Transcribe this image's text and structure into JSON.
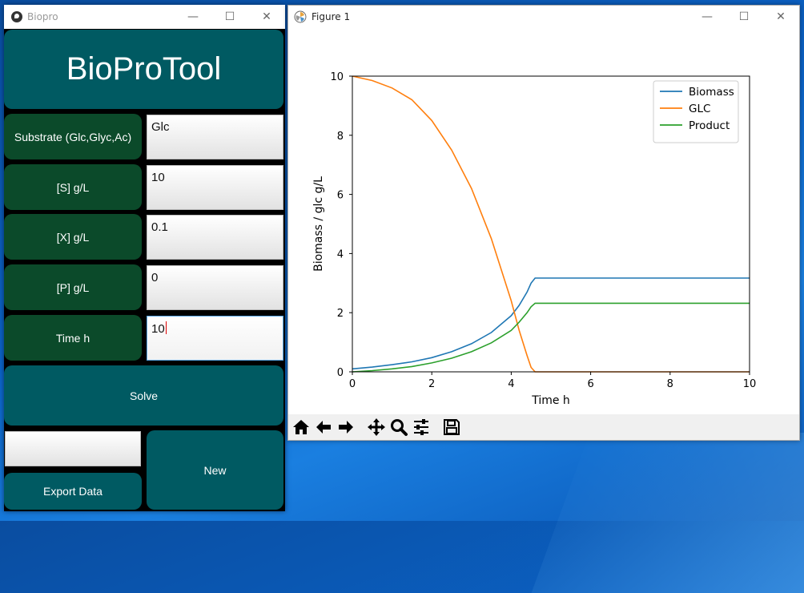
{
  "biopro": {
    "window_title": "Biopro",
    "heading": "BioProTool",
    "rows": [
      {
        "label": "Substrate (Glc,Glyc,Ac)",
        "value": "Glc"
      },
      {
        "label": "[S] g/L",
        "value": "10"
      },
      {
        "label": "[X] g/L",
        "value": "0.1"
      },
      {
        "label": "[P] g/L",
        "value": "0"
      },
      {
        "label": "Time h",
        "value": "10"
      }
    ],
    "solve_label": "Solve",
    "export_field_value": "",
    "export_label": "Export Data",
    "new_label": "New"
  },
  "figure": {
    "window_title": "Figure 1",
    "toolbar_icons": [
      "home-icon",
      "back-arrow-icon",
      "forward-arrow-icon",
      "pan-icon",
      "zoom-icon",
      "configure-subplots-icon",
      "save-icon"
    ]
  },
  "window_controls": {
    "minimize": "—",
    "maximize": "☐",
    "close": "✕"
  },
  "chart_data": {
    "type": "line",
    "title": "",
    "xlabel": "Time h",
    "ylabel": "Biomass / glc g/L",
    "xlim": [
      0,
      10
    ],
    "ylim": [
      0,
      10
    ],
    "xticks": [
      "0",
      "2",
      "4",
      "6",
      "8",
      "10"
    ],
    "yticks": [
      "0",
      "2",
      "4",
      "6",
      "8",
      "10"
    ],
    "grid": false,
    "legend_position": "top-right",
    "series": [
      {
        "name": "Biomass",
        "color": "#1f77b4",
        "x": [
          0,
          0.5,
          1,
          1.5,
          2,
          2.5,
          3,
          3.5,
          4,
          4.2,
          4.4,
          4.5,
          4.6,
          5,
          6,
          7,
          8,
          9,
          10
        ],
        "y": [
          0.1,
          0.16,
          0.24,
          0.34,
          0.48,
          0.68,
          0.95,
          1.33,
          1.9,
          2.25,
          2.7,
          3.0,
          3.17,
          3.17,
          3.17,
          3.17,
          3.17,
          3.17,
          3.17
        ]
      },
      {
        "name": "GLC",
        "color": "#ff7f0e",
        "x": [
          0,
          0.5,
          1,
          1.5,
          2,
          2.5,
          3,
          3.5,
          4,
          4.2,
          4.4,
          4.5,
          4.6,
          5,
          6,
          7,
          8,
          9,
          10
        ],
        "y": [
          10,
          9.85,
          9.6,
          9.2,
          8.5,
          7.5,
          6.2,
          4.5,
          2.4,
          1.4,
          0.55,
          0.15,
          0.0,
          0.0,
          0.0,
          0.0,
          0.0,
          0.0,
          0.0
        ]
      },
      {
        "name": "Product",
        "color": "#2ca02c",
        "x": [
          0,
          0.5,
          1,
          1.5,
          2,
          2.5,
          3,
          3.5,
          4,
          4.2,
          4.4,
          4.5,
          4.6,
          5,
          6,
          7,
          8,
          9,
          10
        ],
        "y": [
          0.0,
          0.04,
          0.1,
          0.18,
          0.3,
          0.46,
          0.68,
          0.98,
          1.4,
          1.68,
          2.0,
          2.2,
          2.32,
          2.32,
          2.32,
          2.32,
          2.32,
          2.32,
          2.32
        ]
      }
    ]
  }
}
